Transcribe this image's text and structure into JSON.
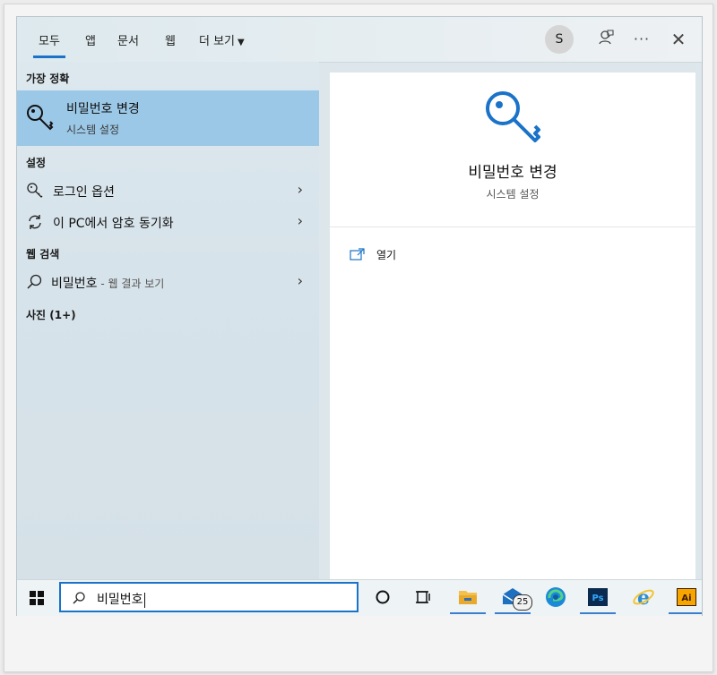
{
  "tabs": [
    {
      "label": "모두"
    },
    {
      "label": "앱"
    },
    {
      "label": "문서"
    },
    {
      "label": "웹"
    },
    {
      "label": "더 보기"
    }
  ],
  "account": {
    "initial": "S"
  },
  "left": {
    "best_match": {
      "heading": "가장 정확",
      "title": "비밀번호 변경",
      "subtitle": "시스템 설정",
      "icon": "key-icon"
    },
    "settings": {
      "heading": "설정",
      "items": [
        {
          "label": "로그인 옵션",
          "icon": "key-outline-icon"
        },
        {
          "label": "이 PC에서 암호 동기화",
          "icon": "sync-icon"
        }
      ]
    },
    "web": {
      "heading": "웹 검색",
      "item": {
        "label": "비밀번호",
        "suffix": " - 웹 결과 보기",
        "icon": "search-icon"
      }
    },
    "photos": {
      "heading": "사진 (1+)"
    }
  },
  "right": {
    "title": "비밀번호 변경",
    "subtitle": "시스템 설정",
    "icon": "key-icon",
    "actions": [
      {
        "label": "열기",
        "icon": "open-icon"
      }
    ]
  },
  "taskbar": {
    "search_query": "비밀번호",
    "mail_badge": "25",
    "apps": [
      "cortana-icon",
      "task-view-icon",
      "file-explorer-icon",
      "mail-icon",
      "edge-icon",
      "photoshop-icon",
      "internet-explorer-icon",
      "illustrator-icon"
    ],
    "ps_label": "Ps",
    "ai_label": "Ai"
  },
  "colors": {
    "accent": "#1a73c9",
    "selected": "#9bc8e7"
  }
}
